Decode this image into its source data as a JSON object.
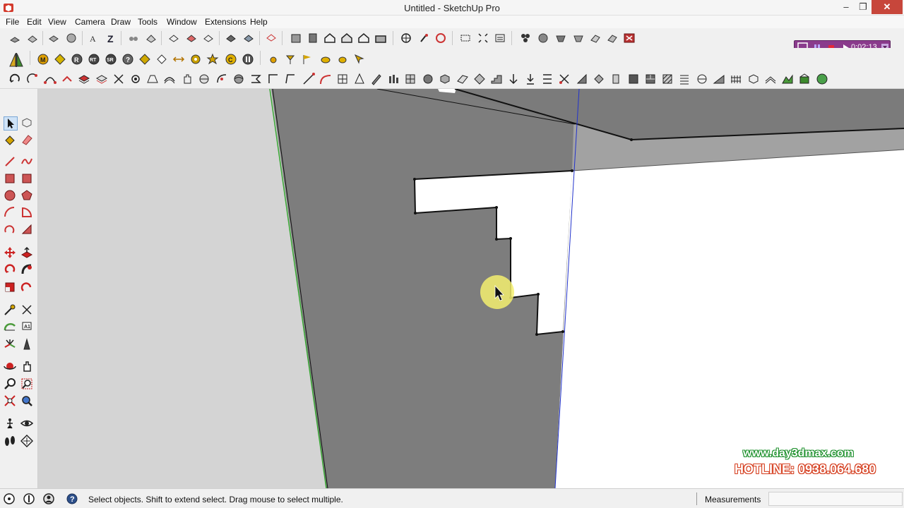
{
  "window": {
    "title": "Untitled - SketchUp Pro",
    "min_glyph": "–",
    "max_glyph": "❐",
    "close_glyph": "✕"
  },
  "menu": {
    "items": [
      "File",
      "Edit",
      "View",
      "Camera",
      "Draw",
      "Tools",
      "Window",
      "Extensions",
      "Help"
    ]
  },
  "recorder": {
    "time": "0:02:13",
    "color": "#8a3b8c"
  },
  "watermark": {
    "url": "www.day3dmax.com",
    "hotline": "HOTLINE: 0938.064.680"
  },
  "status": {
    "message": "Select objects. Shift to extend select. Drag mouse to select multiple.",
    "measurements_label": "Measurements",
    "measurements_value": ""
  },
  "colors": {
    "dark_face": "#7d7d7d",
    "light_face": "#d4d4d4",
    "white_face": "#ffffff",
    "edge": "#111111",
    "blue_axis": "#2233cc",
    "green_axis": "#3aa835",
    "cursor_highlight": "#f3ee6e"
  },
  "icons": {
    "left_toolbar": [
      "select-icon",
      "make-component-icon",
      "paint-bucket-icon",
      "eraser-icon",
      "line-icon",
      "freehand-icon",
      "rectangle-icon",
      "rotated-rectangle-icon",
      "circle-icon",
      "polygon-icon",
      "arc-icon",
      "pie-icon",
      "two-point-arc-icon",
      "three-point-arc-icon",
      "move-icon",
      "push-pull-icon",
      "rotate-icon",
      "follow-me-icon",
      "scale-icon",
      "offset-icon",
      "tape-measure-icon",
      "dimension-icon",
      "protractor-icon",
      "text-icon",
      "axes-icon",
      "3d-text-icon",
      "orbit-icon",
      "pan-icon",
      "zoom-icon",
      "zoom-window-icon",
      "zoom-extents-icon",
      "previous-view-icon",
      "position-camera-icon",
      "look-around-icon",
      "walk-icon",
      "section-plane-icon"
    ]
  }
}
